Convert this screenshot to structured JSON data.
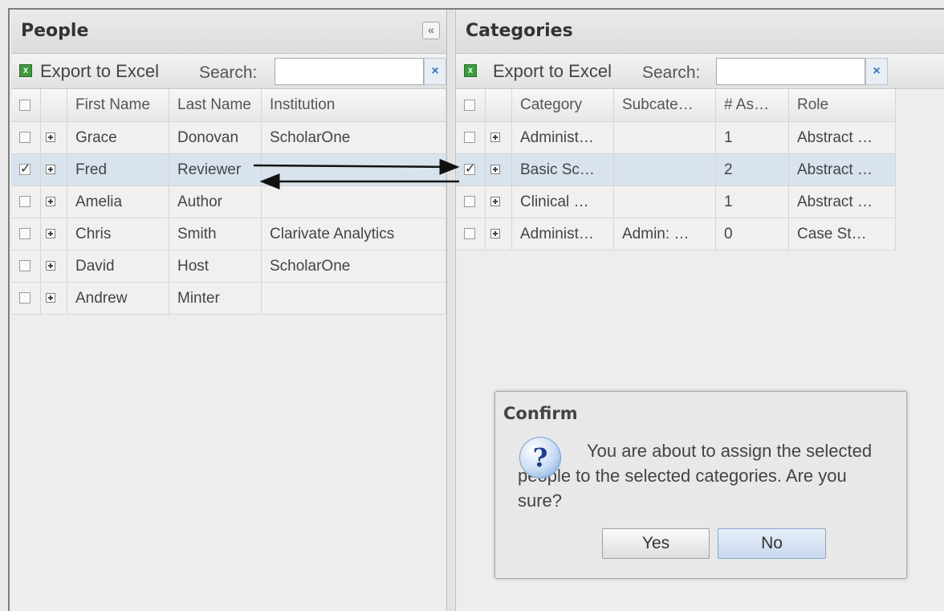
{
  "people_panel": {
    "title": "People",
    "collapse_icon": "double-chevron-left-icon",
    "collapse_glyph": "«",
    "export_label": "Export to Excel",
    "search_label": "Search:",
    "search_value": "",
    "search_clear": "×",
    "columns": [
      "First Name",
      "Last Name",
      "Institution"
    ],
    "rows": [
      {
        "checked": false,
        "first": "Grace",
        "last": "Donovan",
        "institution": "ScholarOne"
      },
      {
        "checked": true,
        "first": "Fred",
        "last": "Reviewer",
        "institution": ""
      },
      {
        "checked": false,
        "first": "Amelia",
        "last": "Author",
        "institution": ""
      },
      {
        "checked": false,
        "first": "Chris",
        "last": "Smith",
        "institution": "Clarivate Analytics"
      },
      {
        "checked": false,
        "first": "David",
        "last": "Host",
        "institution": "ScholarOne"
      },
      {
        "checked": false,
        "first": "Andrew",
        "last": "Minter",
        "institution": ""
      }
    ]
  },
  "categories_panel": {
    "title": "Categories",
    "export_label": "Export to Excel",
    "search_label": "Search:",
    "search_value": "",
    "search_clear": "×",
    "columns": [
      "Category",
      "Subcate…",
      "# As…",
      "Role"
    ],
    "rows": [
      {
        "checked": false,
        "category": "Administ…",
        "subcategory": "",
        "assigned": "1",
        "role": "Abstract …"
      },
      {
        "checked": true,
        "category": "Basic Sc…",
        "subcategory": "",
        "assigned": "2",
        "role": "Abstract …"
      },
      {
        "checked": false,
        "category": "Clinical …",
        "subcategory": "",
        "assigned": "1",
        "role": "Abstract …"
      },
      {
        "checked": false,
        "category": "Administ…",
        "subcategory": "Admin: …",
        "assigned": "0",
        "role": "Case St…"
      }
    ]
  },
  "dialog": {
    "title": "Confirm",
    "icon": "question-icon",
    "icon_glyph": "?",
    "message": "You are about to assign the selected people to the selected categories. Are you sure?",
    "yes_label": "Yes",
    "no_label": "No"
  },
  "colors": {
    "selected_row": "#d9e3ee",
    "panel_bg": "#ededed",
    "excel_icon": "#3d9a3d"
  }
}
